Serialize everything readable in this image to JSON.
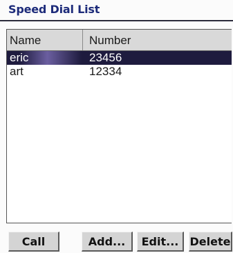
{
  "window": {
    "title": "Speed Dial List"
  },
  "list": {
    "columns": [
      "Name",
      "Number"
    ],
    "rows": [
      {
        "name": "eric",
        "number": "23456",
        "selected": true
      },
      {
        "name": "art",
        "number": "12334",
        "selected": false
      }
    ]
  },
  "buttons": {
    "call": "Call",
    "add": "Add...",
    "edit": "Edit...",
    "delete": "Delete"
  },
  "colors": {
    "title": "#1d2b7a",
    "selection": "#1e1b3e"
  }
}
